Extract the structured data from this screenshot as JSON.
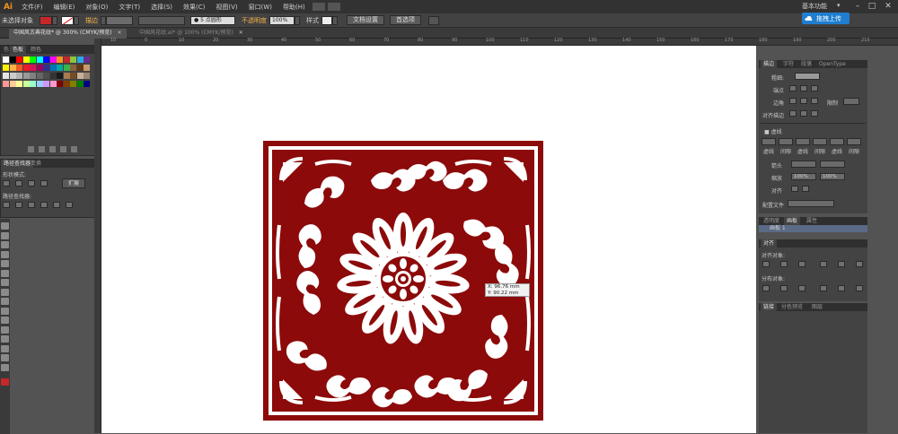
{
  "app": {
    "logo": "Ai"
  },
  "menu": {
    "items": [
      "文件(F)",
      "编辑(E)",
      "对象(O)",
      "文字(T)",
      "选择(S)",
      "效果(C)",
      "视图(V)",
      "窗口(W)",
      "帮助(H)"
    ]
  },
  "window": {
    "workspace": "基本功能",
    "minimize": "–",
    "maximize": "□",
    "close": "✕"
  },
  "upload_button": {
    "label": "拖拽上传"
  },
  "control_bar": {
    "selection": "未选择对象",
    "stroke_label": "描边",
    "brush_size": "5 点圆形",
    "opacity_label": "不透明度",
    "opacity_value": "100%",
    "style_label": "样式",
    "doc_setup": "文档设置",
    "preferences": "首选项"
  },
  "tabs": [
    {
      "label": "中国风古典花纹* @ 300% (CMYK/预览)",
      "close": "✕"
    },
    {
      "label": "中国风花纹.ai* @ 100% (CMYK/预览)",
      "close": "✕"
    }
  ],
  "ruler": {
    "ticks": [
      "10",
      "0",
      "10",
      "20",
      "30",
      "40",
      "50",
      "60",
      "70",
      "80",
      "90",
      "100",
      "110",
      "120",
      "130",
      "140",
      "150",
      "160",
      "170",
      "180",
      "190",
      "200",
      "210"
    ]
  },
  "left_panels": {
    "color_tabs": [
      "色",
      "色板",
      "颜色"
    ],
    "pathfinder_tabs": [
      "路径查找器",
      "变换"
    ],
    "shape_mode_label": "形状模式:",
    "expand_button": "扩展",
    "pathfinder_label": "路径查找器:"
  },
  "right_panel": {
    "stroke_tabs": [
      "描边",
      "字符",
      "段落",
      "OpenType"
    ],
    "weight_label": "粗细:",
    "cap_label": "端点",
    "corner_label": "边角",
    "limit_label": "限制",
    "align_stroke_label": "对齐描边",
    "dashed_label": "虚线",
    "dash_cells": [
      "虚线",
      "间隙",
      "虚线",
      "间隙",
      "虚线",
      "间隙"
    ],
    "arrowhead_label": "箭头",
    "scale_label": "缩放",
    "scale_value1": "100%",
    "scale_value2": "100%",
    "align_label": "对齐",
    "profile_label": "配置文件",
    "layer_tabs": [
      "透明度",
      "画板",
      "属性"
    ],
    "layer_row": "画板 1",
    "align_panel_tab": "对齐",
    "align_objects_label": "对齐对象:",
    "distribute_label": "分布对象:",
    "bottom_tabs": [
      "链接",
      "分色预览",
      "图层"
    ]
  },
  "cursor_readout": {
    "x": "X: 96.76 mm",
    "y": "Y: 90.22 mm"
  },
  "colors": {
    "artwork_red": "#8c0a0a",
    "ui_dark": "#323232",
    "ui_panel": "#434343",
    "accent": "#f7931e",
    "upload_blue": "#1f7ed0"
  }
}
